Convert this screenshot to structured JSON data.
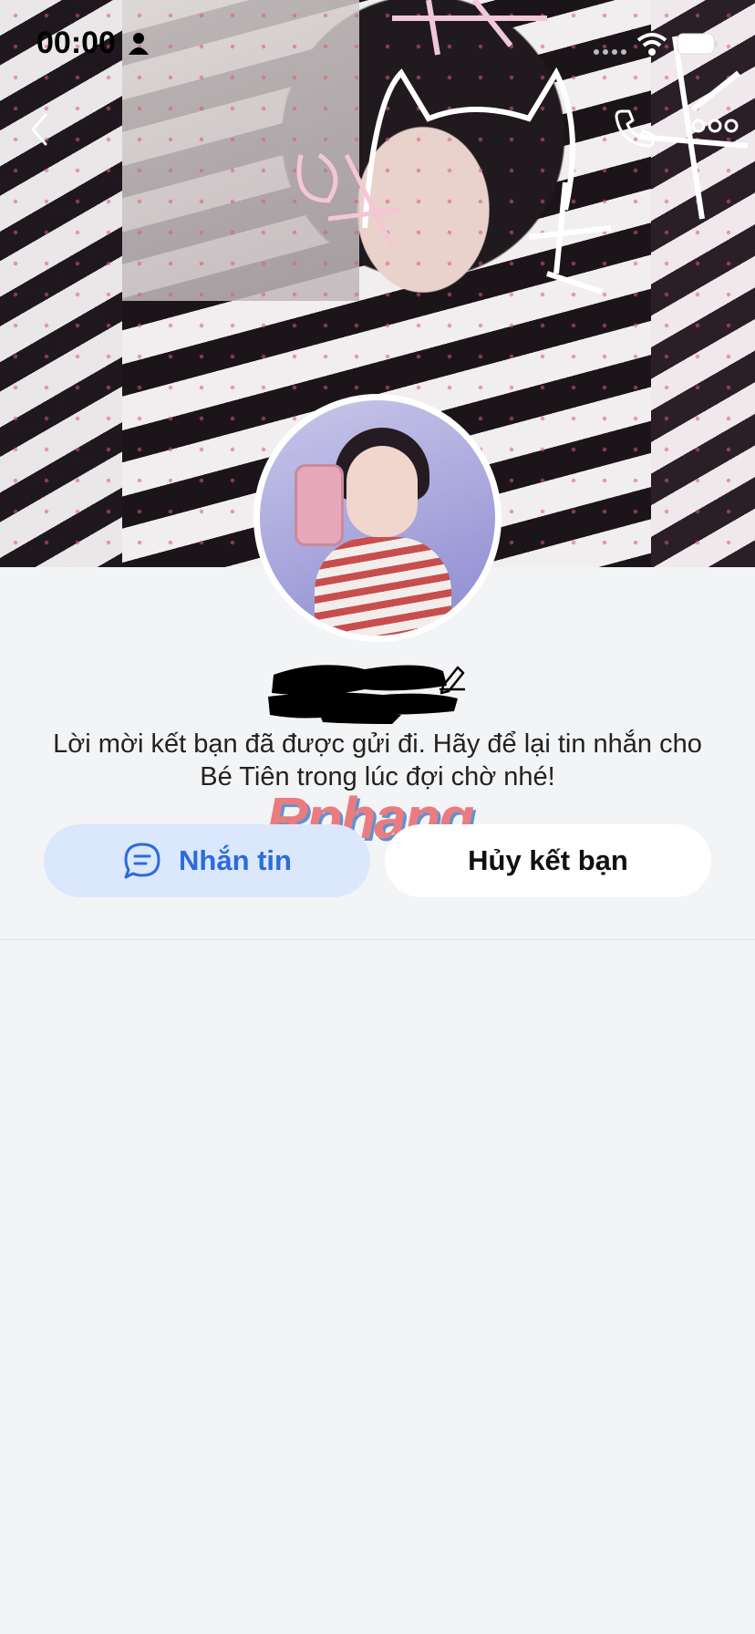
{
  "status_bar": {
    "time": "00:00",
    "icons": [
      "person-icon",
      "signal-icon",
      "wifi-icon",
      "battery-icon"
    ]
  },
  "nav": {
    "icons": [
      "back-icon",
      "phone-icon",
      "more-icon"
    ]
  },
  "profile": {
    "name": "",
    "info_message": "Lời mời kết bạn đã được gửi đi. Hãy để lại tin nhắn cho Bé Tiên trong lúc đợi chờ nhé!"
  },
  "watermark": "Rphang",
  "actions": {
    "message_label": "Nhắn tin",
    "cancel_label": "Hủy kết bạn"
  },
  "colors": {
    "accent": "#2b6bdc",
    "message_button_bg": "#dbe7fd",
    "page_bg": "#f3f4f6"
  }
}
